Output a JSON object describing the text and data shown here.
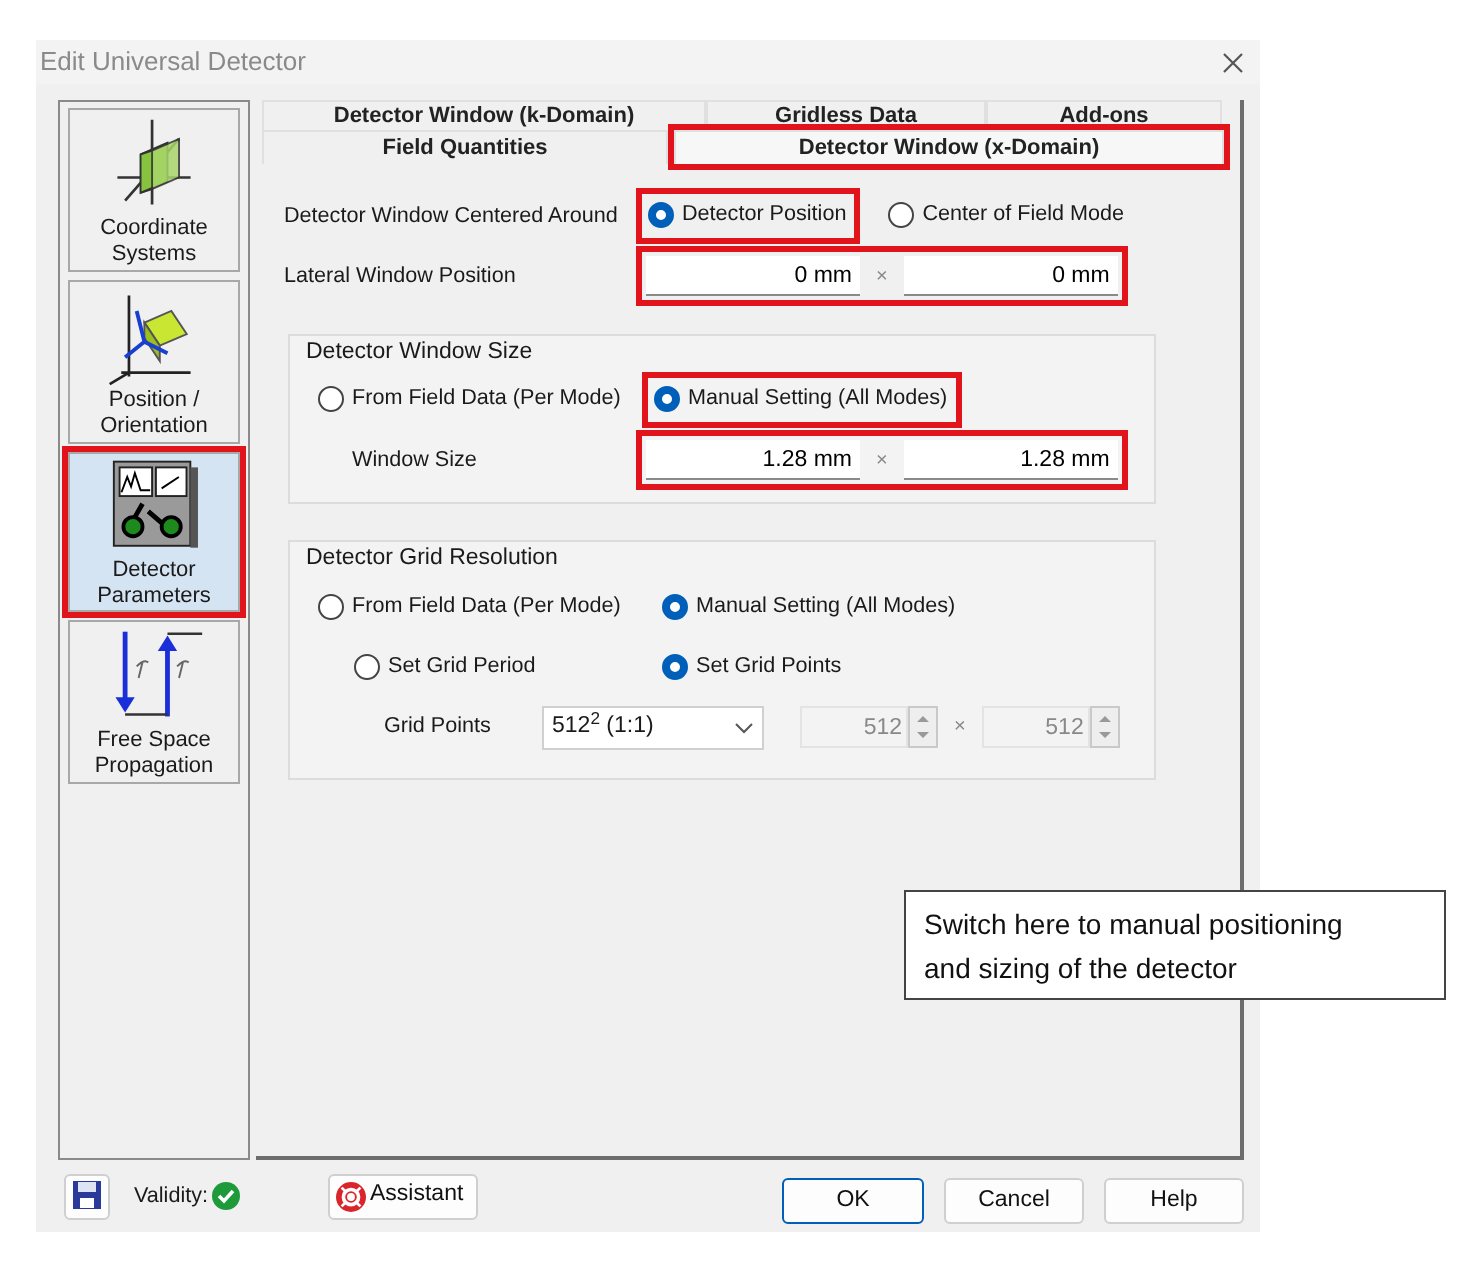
{
  "window": {
    "title": "Edit Universal Detector"
  },
  "sidebar": {
    "items": [
      {
        "label": "Coordinate Systems",
        "kind": "coordinates",
        "selected": false,
        "highlighted": false
      },
      {
        "label": "Position / Orientation",
        "kind": "position",
        "selected": false,
        "highlighted": false
      },
      {
        "label": "Detector Parameters",
        "kind": "detector",
        "selected": true,
        "highlighted": true
      },
      {
        "label": "Free Space Propagation",
        "kind": "propagation",
        "selected": false,
        "highlighted": false
      }
    ]
  },
  "tabs": {
    "rows": [
      [
        {
          "label": "Detector Window (k-Domain)",
          "selected": false,
          "highlighted": false
        },
        {
          "label": "Gridless Data",
          "selected": false,
          "highlighted": false
        },
        {
          "label": "Add-ons",
          "selected": false,
          "highlighted": false
        }
      ],
      [
        {
          "label": "Field Quantities",
          "selected": false,
          "highlighted": false
        },
        {
          "label": "Detector Window (x-Domain)",
          "selected": true,
          "highlighted": true
        }
      ]
    ]
  },
  "centered_around": {
    "label": "Detector Window Centered Around",
    "options": [
      {
        "label": "Detector Position",
        "selected": true,
        "highlighted": true
      },
      {
        "label": "Center of Field Mode",
        "selected": false,
        "highlighted": false
      }
    ]
  },
  "lateral_position": {
    "label": "Lateral Window Position",
    "values": [
      "0 mm",
      "0 mm"
    ],
    "separator": "×",
    "highlighted": true
  },
  "window_size_group": {
    "title": "Detector Window Size",
    "options": [
      {
        "label": "From Field Data (Per Mode)",
        "selected": false,
        "highlighted": false
      },
      {
        "label": "Manual Setting (All Modes)",
        "selected": true,
        "highlighted": true
      }
    ],
    "size": {
      "label": "Window Size",
      "values": [
        "1.28 mm",
        "1.28 mm"
      ],
      "separator": "×",
      "highlighted": true
    }
  },
  "grid_group": {
    "title": "Detector Grid Resolution",
    "options": [
      {
        "label": "From Field Data (Per Mode)",
        "selected": false
      },
      {
        "label": "Manual Setting (All Modes)",
        "selected": true
      }
    ],
    "sub_options": [
      {
        "label": "Set Grid Period",
        "selected": false
      },
      {
        "label": "Set Grid Points",
        "selected": true
      }
    ],
    "grid_points": {
      "label": "Grid Points",
      "select_value": "512$^{2}$ (1:1)",
      "separator": "×",
      "spinners": [
        {
          "value": "512",
          "disabled": true
        },
        {
          "value": "512",
          "disabled": true
        }
      ]
    }
  },
  "footer": {
    "validity_label": "Validity:",
    "assistant": "Assistant",
    "buttons": [
      {
        "label": "OK",
        "default": true
      },
      {
        "label": "Cancel",
        "default": false
      },
      {
        "label": "Help",
        "default": false
      }
    ]
  },
  "callout": {
    "text": "Switch here to manual positioning and sizing of the detector"
  }
}
